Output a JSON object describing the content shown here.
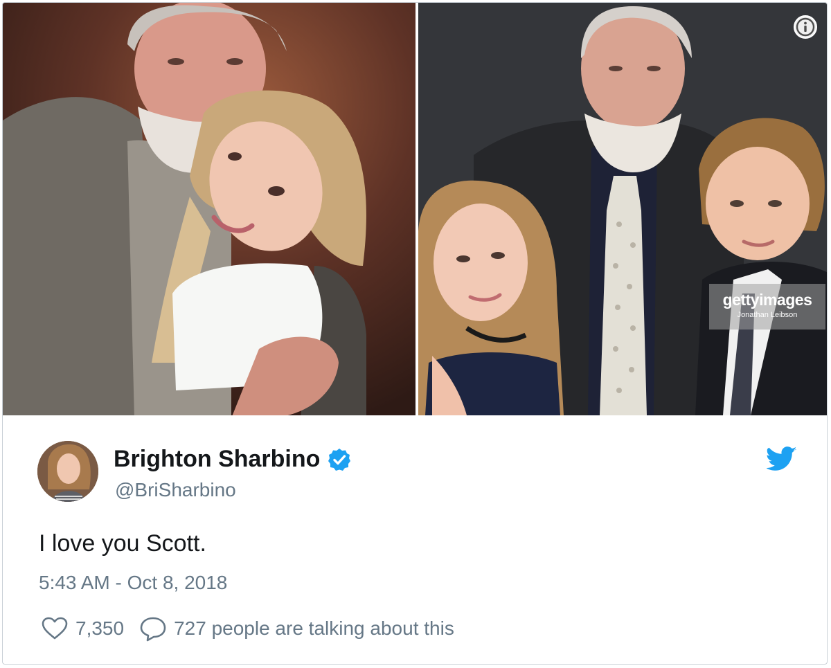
{
  "tweet": {
    "author_name": "Brighton Sharbino",
    "handle": "@BriSharbino",
    "text": "I love you Scott.",
    "timestamp": "5:43 AM - Oct 8, 2018",
    "likes": "7,350",
    "conversation": "727 people are talking about this"
  },
  "media": {
    "watermark_brand": "gettyimages",
    "watermark_credit": "Jonathan Leibson"
  },
  "icons": {
    "info": "info-icon",
    "verified": "verified-badge-icon",
    "brand": "twitter-bird-icon",
    "like": "heart-icon",
    "reply": "speech-bubble-icon"
  },
  "colors": {
    "brand_blue": "#1da1f2",
    "secondary_text": "#657786",
    "primary_text": "#14171a"
  }
}
